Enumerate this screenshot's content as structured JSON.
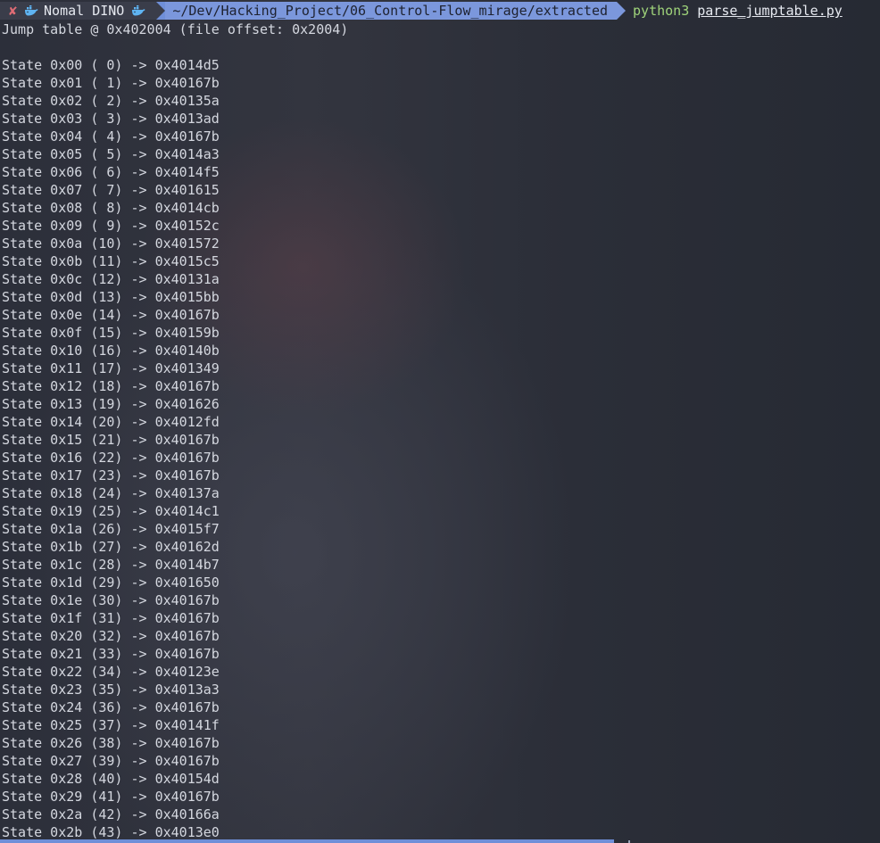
{
  "prompt": {
    "status_symbol": "✘",
    "user_label": "Nomal DINO",
    "path": "~/Dev/Hacking_Project/06_Control-Flow_mirage/extracted",
    "command": "python3",
    "argument": "parse_jumptable.py"
  },
  "output": {
    "header": "Jump table @ 0x402004 (file offset: 0x2004)",
    "rows": [
      "State 0x00 ( 0) -> 0x4014d5",
      "State 0x01 ( 1) -> 0x40167b",
      "State 0x02 ( 2) -> 0x40135a",
      "State 0x03 ( 3) -> 0x4013ad",
      "State 0x04 ( 4) -> 0x40167b",
      "State 0x05 ( 5) -> 0x4014a3",
      "State 0x06 ( 6) -> 0x4014f5",
      "State 0x07 ( 7) -> 0x401615",
      "State 0x08 ( 8) -> 0x4014cb",
      "State 0x09 ( 9) -> 0x40152c",
      "State 0x0a (10) -> 0x401572",
      "State 0x0b (11) -> 0x4015c5",
      "State 0x0c (12) -> 0x40131a",
      "State 0x0d (13) -> 0x4015bb",
      "State 0x0e (14) -> 0x40167b",
      "State 0x0f (15) -> 0x40159b",
      "State 0x10 (16) -> 0x40140b",
      "State 0x11 (17) -> 0x401349",
      "State 0x12 (18) -> 0x40167b",
      "State 0x13 (19) -> 0x401626",
      "State 0x14 (20) -> 0x4012fd",
      "State 0x15 (21) -> 0x40167b",
      "State 0x16 (22) -> 0x40167b",
      "State 0x17 (23) -> 0x40167b",
      "State 0x18 (24) -> 0x40137a",
      "State 0x19 (25) -> 0x4014c1",
      "State 0x1a (26) -> 0x4015f7",
      "State 0x1b (27) -> 0x40162d",
      "State 0x1c (28) -> 0x4014b7",
      "State 0x1d (29) -> 0x401650",
      "State 0x1e (30) -> 0x40167b",
      "State 0x1f (31) -> 0x40167b",
      "State 0x20 (32) -> 0x40167b",
      "State 0x21 (33) -> 0x40167b",
      "State 0x22 (34) -> 0x40123e",
      "State 0x23 (35) -> 0x4013a3",
      "State 0x24 (36) -> 0x40167b",
      "State 0x25 (37) -> 0x40141f",
      "State 0x26 (38) -> 0x40167b",
      "State 0x27 (39) -> 0x40167b",
      "State 0x28 (40) -> 0x40154d",
      "State 0x29 (41) -> 0x40167b",
      "State 0x2a (42) -> 0x40166a",
      "State 0x2b (43) -> 0x4013e0"
    ]
  },
  "icons": {
    "status": "error-x-icon",
    "user": "docker-whale-icon"
  },
  "colors": {
    "status_error": "#e06c75",
    "path_segment": "#7b97dc",
    "command": "#9fd37a",
    "text": "#d4d7df",
    "background": "#2a2d38"
  }
}
